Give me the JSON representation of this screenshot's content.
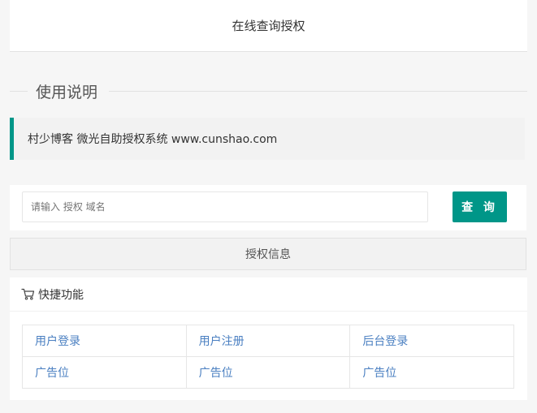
{
  "header": {
    "title": "在线查询授权"
  },
  "usage": {
    "legend": "使用说明",
    "quote": "村少博客 微光自助授权系统 www.cunshao.com"
  },
  "search": {
    "placeholder": "请输入 授权 域名",
    "value": "",
    "button_label": "查 询"
  },
  "auth_info": {
    "label": "授权信息"
  },
  "quick": {
    "title": "快捷功能",
    "icon": "cart-icon",
    "rows": [
      [
        "用户登录",
        "用户注册",
        "后台登录"
      ],
      [
        "广告位",
        "广告位",
        "广告位"
      ]
    ]
  },
  "colors": {
    "accent": "#009688",
    "link": "#4a7fc1"
  }
}
